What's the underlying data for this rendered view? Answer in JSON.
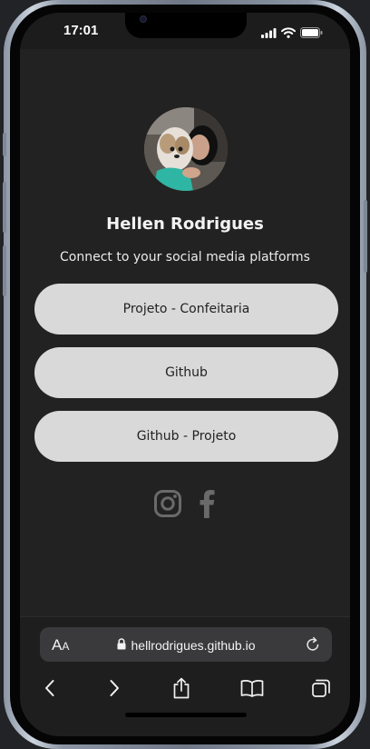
{
  "status_bar": {
    "time": "17:01",
    "icons": [
      "cellular-signal-icon",
      "wifi-icon",
      "battery-icon"
    ]
  },
  "profile": {
    "name": "Hellen Rodrigues",
    "tagline": "Connect to your social media platforms",
    "avatar": "profile-photo"
  },
  "links": [
    {
      "label": "Projeto - Confeitaria"
    },
    {
      "label": "Github"
    },
    {
      "label": "Github - Projeto"
    }
  ],
  "socials": [
    "instagram-icon",
    "facebook-icon"
  ],
  "browser": {
    "aa_big": "A",
    "aa_small": "A",
    "url": "hellrodrigues.github.io",
    "toolbar": [
      "back-icon",
      "forward-icon",
      "share-icon",
      "bookmarks-icon",
      "tabs-icon"
    ]
  },
  "colors": {
    "page_background": "#222222",
    "button_background": "#d9d9d9",
    "button_text": "#222222",
    "browser_bar": "#1e1e1e",
    "address_field": "#3a3a3c"
  }
}
